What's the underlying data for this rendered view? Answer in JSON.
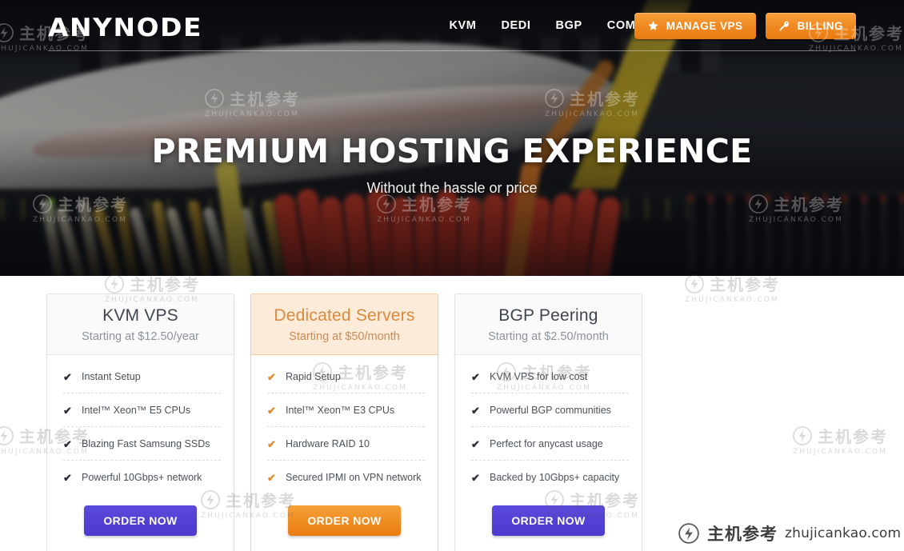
{
  "site": {
    "logo_text": "ANYNODE"
  },
  "nav": {
    "links": [
      {
        "label": "KVM"
      },
      {
        "label": "DEDI"
      },
      {
        "label": "BGP"
      },
      {
        "label": "COMPANY"
      }
    ],
    "buttons": [
      {
        "label": "MANAGE VPS",
        "icon": "star-icon",
        "color": "#f08a22"
      },
      {
        "label": "BILLING",
        "icon": "key-icon",
        "color": "#f08a22"
      }
    ]
  },
  "hero": {
    "title": "PREMIUM HOSTING EXPERIENCE",
    "subtitle": "Without the hassle or price"
  },
  "pricing": {
    "cards": [
      {
        "title": "KVM VPS",
        "price": "Starting at $12.50/year",
        "featured": false,
        "check": "✔",
        "features": [
          "Instant Setup",
          "Intel™ Xeon™ E5 CPUs",
          "Blazing Fast Samsung SSDs",
          "Powerful 10Gbps+ network"
        ],
        "cta": "ORDER NOW",
        "cta_color": "#5241d4"
      },
      {
        "title": "Dedicated Servers",
        "price": "Starting at $50/month",
        "featured": true,
        "check": "✔",
        "features": [
          "Rapid Setup",
          "Intel™ Xeon™ E3 CPUs",
          "Hardware RAID 10",
          "Secured IPMI on VPN network"
        ],
        "cta": "ORDER NOW",
        "cta_color": "#ef8d22"
      },
      {
        "title": "BGP Peering",
        "price": "Starting at $2.50/month",
        "featured": false,
        "check": "✔",
        "features": [
          "KVM VPS for low cost",
          "Powerful BGP communities",
          "Perfect for anycast usage",
          "Backed by 10Gbps+ capacity"
        ],
        "cta": "ORDER NOW",
        "cta_color": "#5241d4"
      }
    ]
  },
  "watermark": {
    "cn": "主机参考",
    "url_caps": "ZHUJICANKAO.COM",
    "url": "zhujicankao.com"
  }
}
